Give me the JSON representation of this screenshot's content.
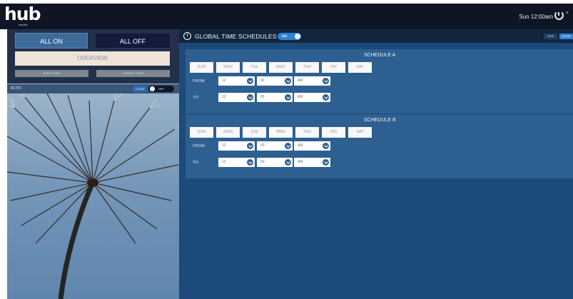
{
  "topbar": {
    "logo_text": "hub",
    "logo_sub": "circuits",
    "clock_text": "Sun 12:00am",
    "clock_mini": "☰"
  },
  "left": {
    "all_on": "ALL ON",
    "all_off": "ALL OFF",
    "overview": "OVERVIEW",
    "sub1": "FUNCTIONS",
    "sub2": "CONNECTIONS",
    "filter_label": "ACTIV",
    "flow_label": "FLOW",
    "toggle_label": "OFF"
  },
  "right": {
    "title": "GLOBAL TIME SCHEDULES",
    "toggle_label": "ON",
    "hide_label": "HIDE",
    "show_label": "SHOW",
    "days": [
      "SUN",
      "MON",
      "TUE",
      "WED",
      "THU",
      "FRI",
      "SAT"
    ],
    "from_label": "FROM:",
    "to_label": "TO:",
    "schedules": [
      {
        "title": "SCHEDULE A",
        "from": {
          "hour": "12",
          "minute": "00",
          "ampm": "AM"
        },
        "to": {
          "hour": "12",
          "minute": "00",
          "ampm": "AM"
        }
      },
      {
        "title": "SCHEDULE B",
        "from": {
          "hour": "12",
          "minute": "00",
          "ampm": "AM"
        },
        "to": {
          "hour": "12",
          "minute": "00",
          "ampm": "AM"
        }
      }
    ]
  },
  "colors": {
    "topbar": "#0f1524",
    "accent": "#2f82d6",
    "panel": "#1c4a7b",
    "schedule": "#2d5f90"
  }
}
